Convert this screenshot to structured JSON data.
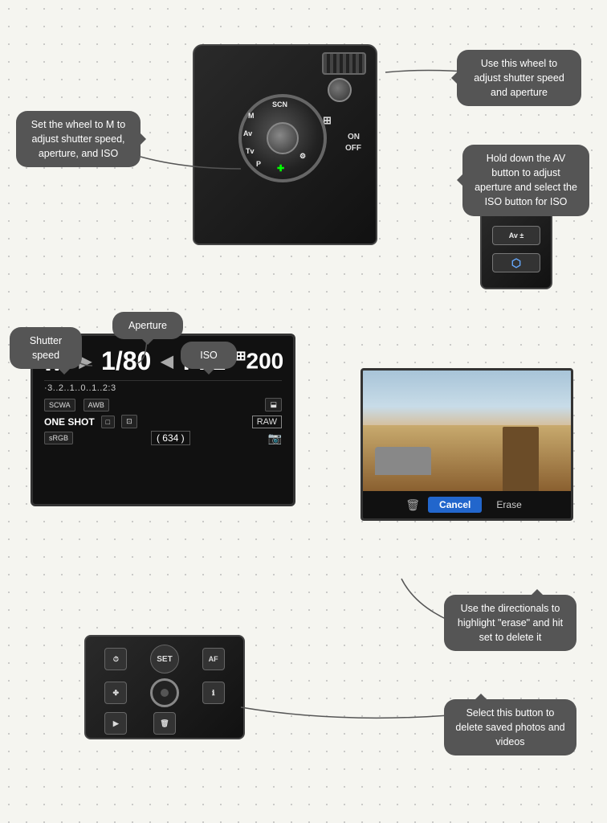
{
  "page": {
    "background": "dotted light gray"
  },
  "callouts": {
    "wheel": "Use this wheel to adjust shutter speed and aperture",
    "av": "Hold down the AV button to adjust aperture and select the ISO button for ISO",
    "set_wheel": "Set the wheel to M to adjust shutter speed, aperture, and ISO",
    "aperture": "Aperture",
    "shutter": "Shutter speed",
    "iso": "ISO",
    "delete": "Select this button to delete saved photos and videos",
    "erase": "Use the directionals to highlight \"erase\" and hit set to delete it"
  },
  "lcd": {
    "mode": "M",
    "arrow1": "▶",
    "shutter": "1/80",
    "arrow2": "◀",
    "aperture": "F11",
    "iso_super": "⊞",
    "iso_val": "200",
    "exposure_bar": "·3..2..1..0..1..2:3",
    "badge1": "SCWA",
    "badge2": "AWB",
    "badge3": "⬓",
    "one_shot": "ONE SHOT",
    "bracket": "□",
    "metering": "⊡",
    "raw": "RAW",
    "srgb": "sRGB",
    "count_label": "( 634 )",
    "card_icon": "📷"
  },
  "room_photo": {
    "cancel_label": "Cancel",
    "erase_label": "Erase"
  },
  "controls": {
    "set_label": "SET",
    "af_label": "AF",
    "play_label": "▶",
    "trash_label": "🗑"
  }
}
